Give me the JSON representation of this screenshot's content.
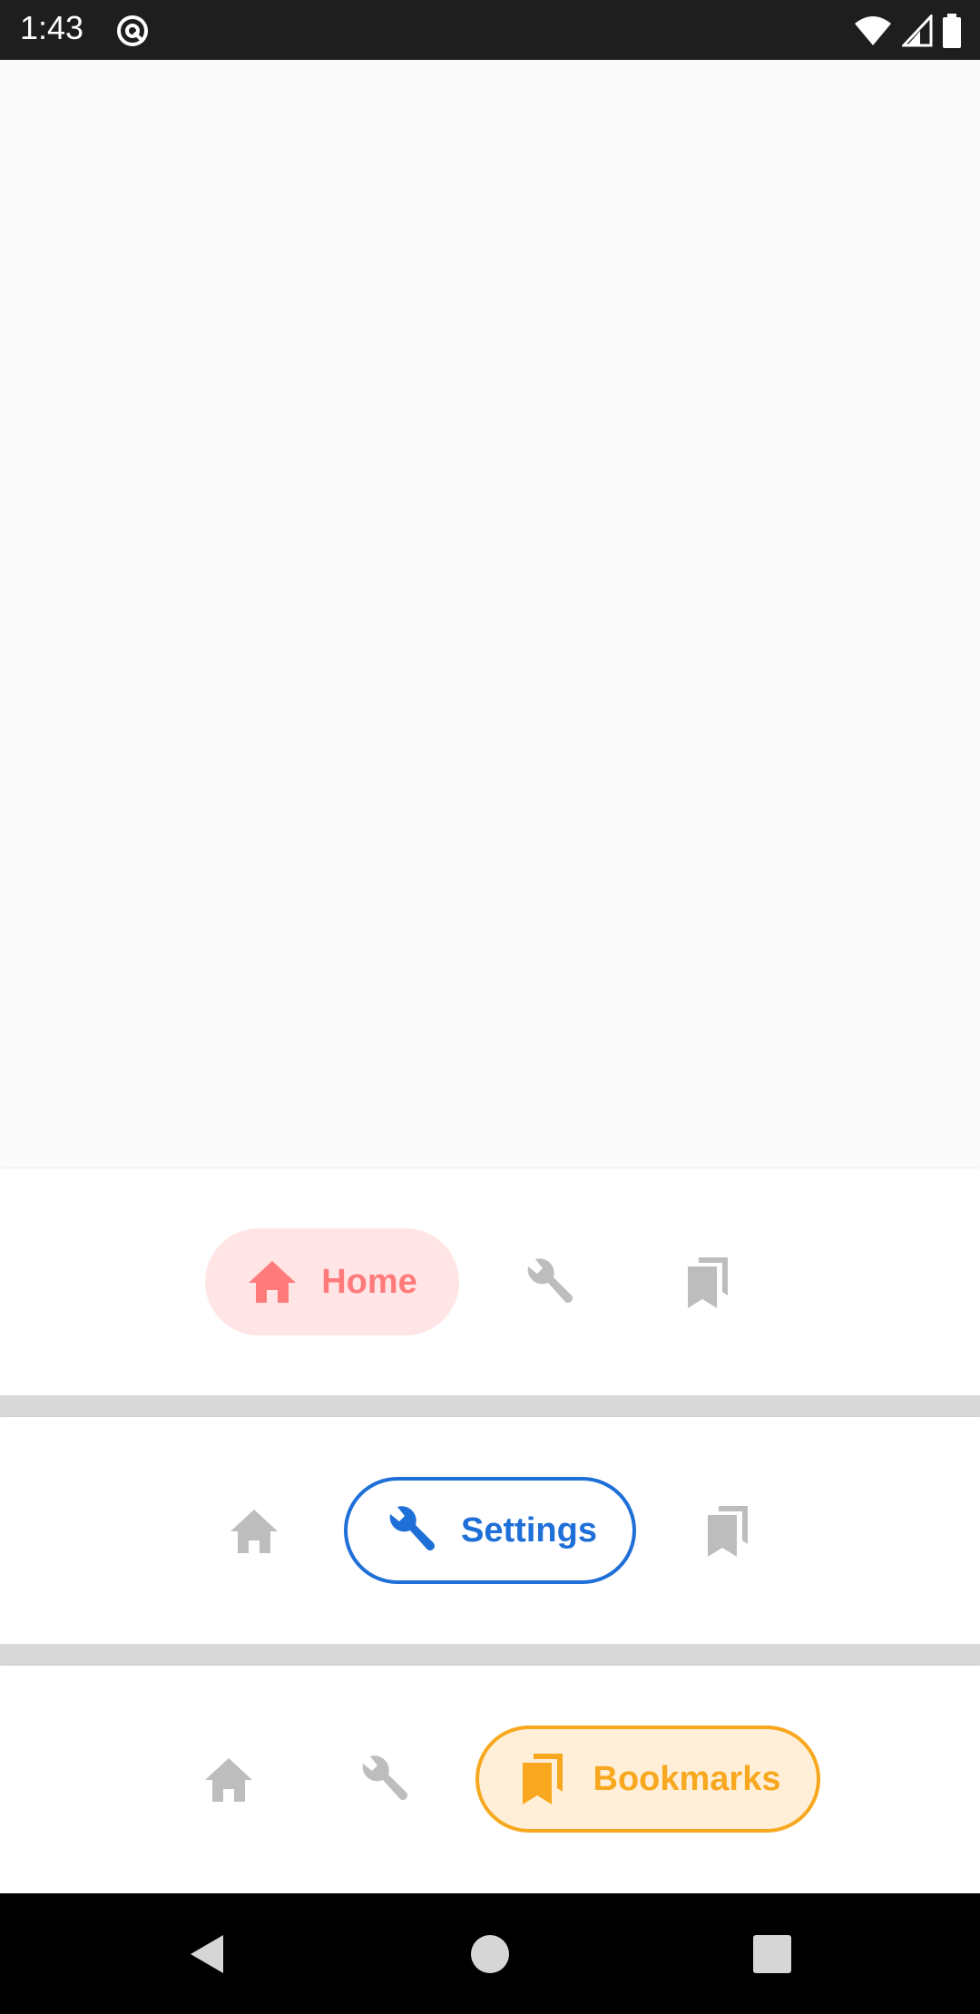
{
  "status_bar": {
    "time": "1:43",
    "icons": [
      "at-sign-icon",
      "wifi-icon",
      "cell-signal-icon",
      "battery-icon"
    ]
  },
  "colors": {
    "home_active": "#ff7b7b",
    "home_active_bg": "#ffe5e5",
    "settings_active": "#1f6fd8",
    "bookmarks_active": "#f7a81f",
    "bookmarks_active_bg": "#ffefd8",
    "inactive": "#bdbdbd"
  },
  "navbars": [
    {
      "active": "home",
      "labels": {
        "home": "Home"
      }
    },
    {
      "active": "settings",
      "labels": {
        "settings": "Settings"
      }
    },
    {
      "active": "bookmarks",
      "labels": {
        "bookmarks": "Bookmarks"
      }
    }
  ],
  "android_nav": {
    "icons": [
      "back-icon",
      "home-circle-icon",
      "recents-square-icon"
    ]
  }
}
